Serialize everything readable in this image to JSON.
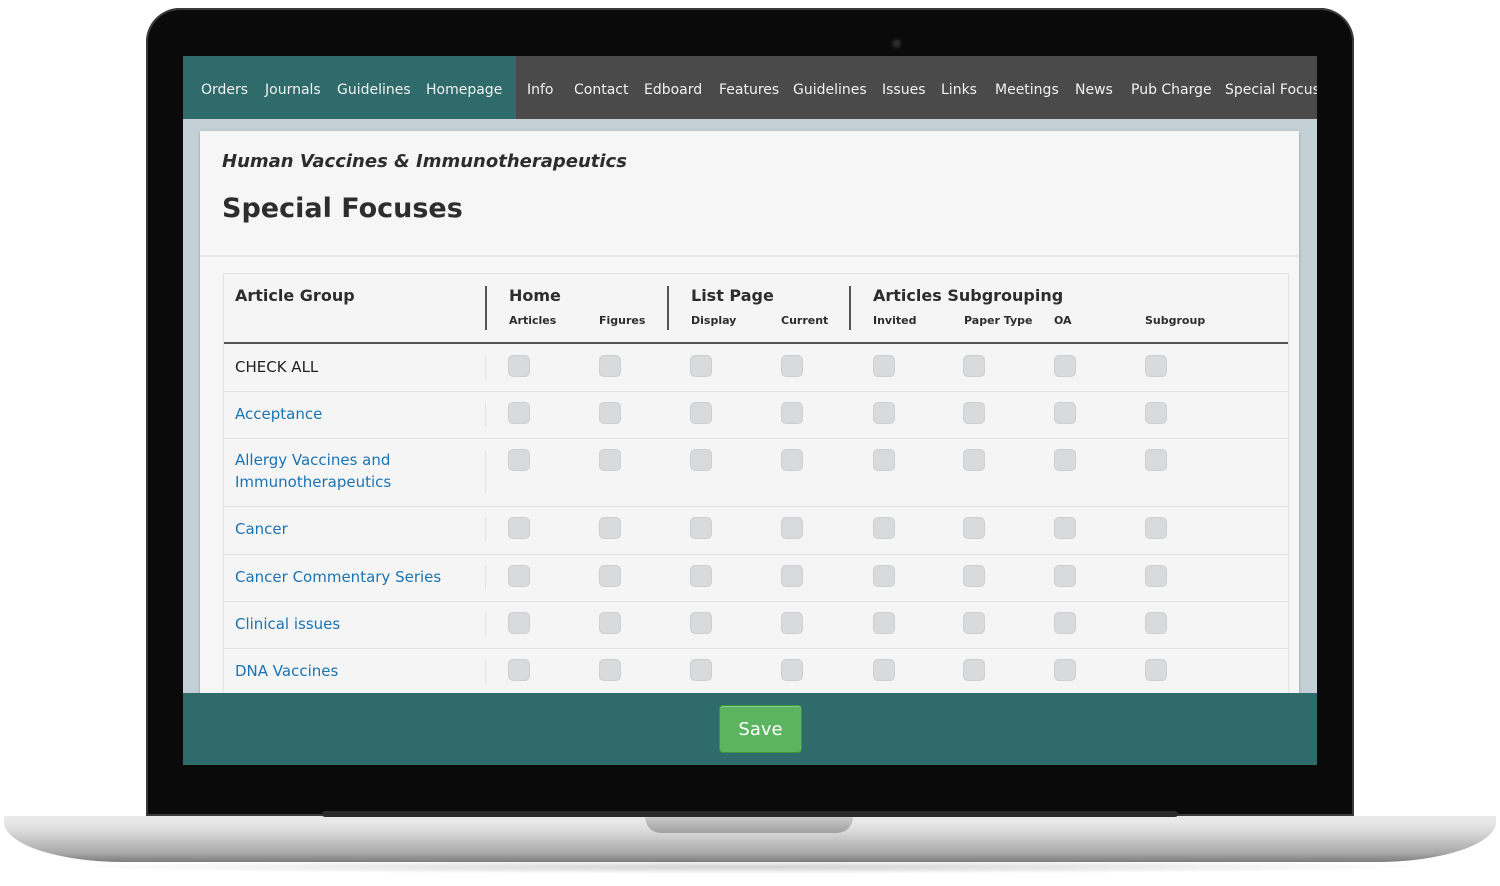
{
  "nav": {
    "left_items": [
      "Orders",
      "Journals",
      "Guidelines",
      "Homepage"
    ],
    "right_items": [
      "Info",
      "Contact",
      "Edboard",
      "Features",
      "Guidelines",
      "Issues",
      "Links",
      "Meetings",
      "News",
      "Pub Charge",
      "Special Focus"
    ]
  },
  "page": {
    "journal_title": "Human Vaccines & Immunotherapeutics",
    "title": "Special Focuses"
  },
  "table": {
    "group_header": "Article Group",
    "column_groups": [
      {
        "label": "Home",
        "columns": [
          "Articles",
          "Figures"
        ]
      },
      {
        "label": "List Page",
        "columns": [
          "Display",
          "Current"
        ]
      },
      {
        "label": "Articles Subgrouping",
        "columns": [
          "Invited",
          "Paper Type",
          "OA",
          "Subgroup"
        ]
      }
    ],
    "rows": [
      {
        "label": "CHECK ALL"
      },
      {
        "label": "Acceptance"
      },
      {
        "label": "Allergy Vaccines and\nImmunotherapeutics"
      },
      {
        "label": "Cancer"
      },
      {
        "label": "Cancer Commentary Series"
      },
      {
        "label": "Clinical issues"
      },
      {
        "label": "DNA Vaccines"
      }
    ]
  },
  "footer": {
    "save_label": "Save"
  },
  "colors": {
    "nav_accent": "#2f6b6b",
    "nav_bg": "#4a4a4a",
    "link": "#1a73b3",
    "save": "#5bb45f"
  }
}
